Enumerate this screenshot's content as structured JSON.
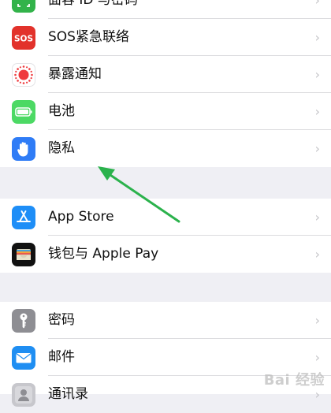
{
  "groups": [
    {
      "items": [
        {
          "label": "面容 ID 与密码",
          "icon": "face-id-icon",
          "color": "#32b34a"
        },
        {
          "label": "SOS紧急联络",
          "icon": "sos-icon",
          "color": "#e2322b",
          "badge": "SOS"
        },
        {
          "label": "暴露通知",
          "icon": "exposure-notification-icon",
          "color": "#ffffff"
        },
        {
          "label": "电池",
          "icon": "battery-icon",
          "color": "#4cd964"
        },
        {
          "label": "隐私",
          "icon": "privacy-hand-icon",
          "color": "#2f7cf6"
        }
      ]
    },
    {
      "items": [
        {
          "label": "App Store",
          "icon": "app-store-icon",
          "color": "#1e8ef7"
        },
        {
          "label": "钱包与 Apple Pay",
          "icon": "wallet-icon",
          "color": "#111111"
        }
      ]
    },
    {
      "items": [
        {
          "label": "密码",
          "icon": "key-icon",
          "color": "#8e8e93"
        },
        {
          "label": "邮件",
          "icon": "mail-icon",
          "color": "#1f8ef2"
        },
        {
          "label": "通讯录",
          "icon": "contacts-icon",
          "color": "#b9b9be"
        }
      ]
    }
  ],
  "chevron": "›",
  "annotation_color": "#2bb24c",
  "watermark": "Bai  经验"
}
